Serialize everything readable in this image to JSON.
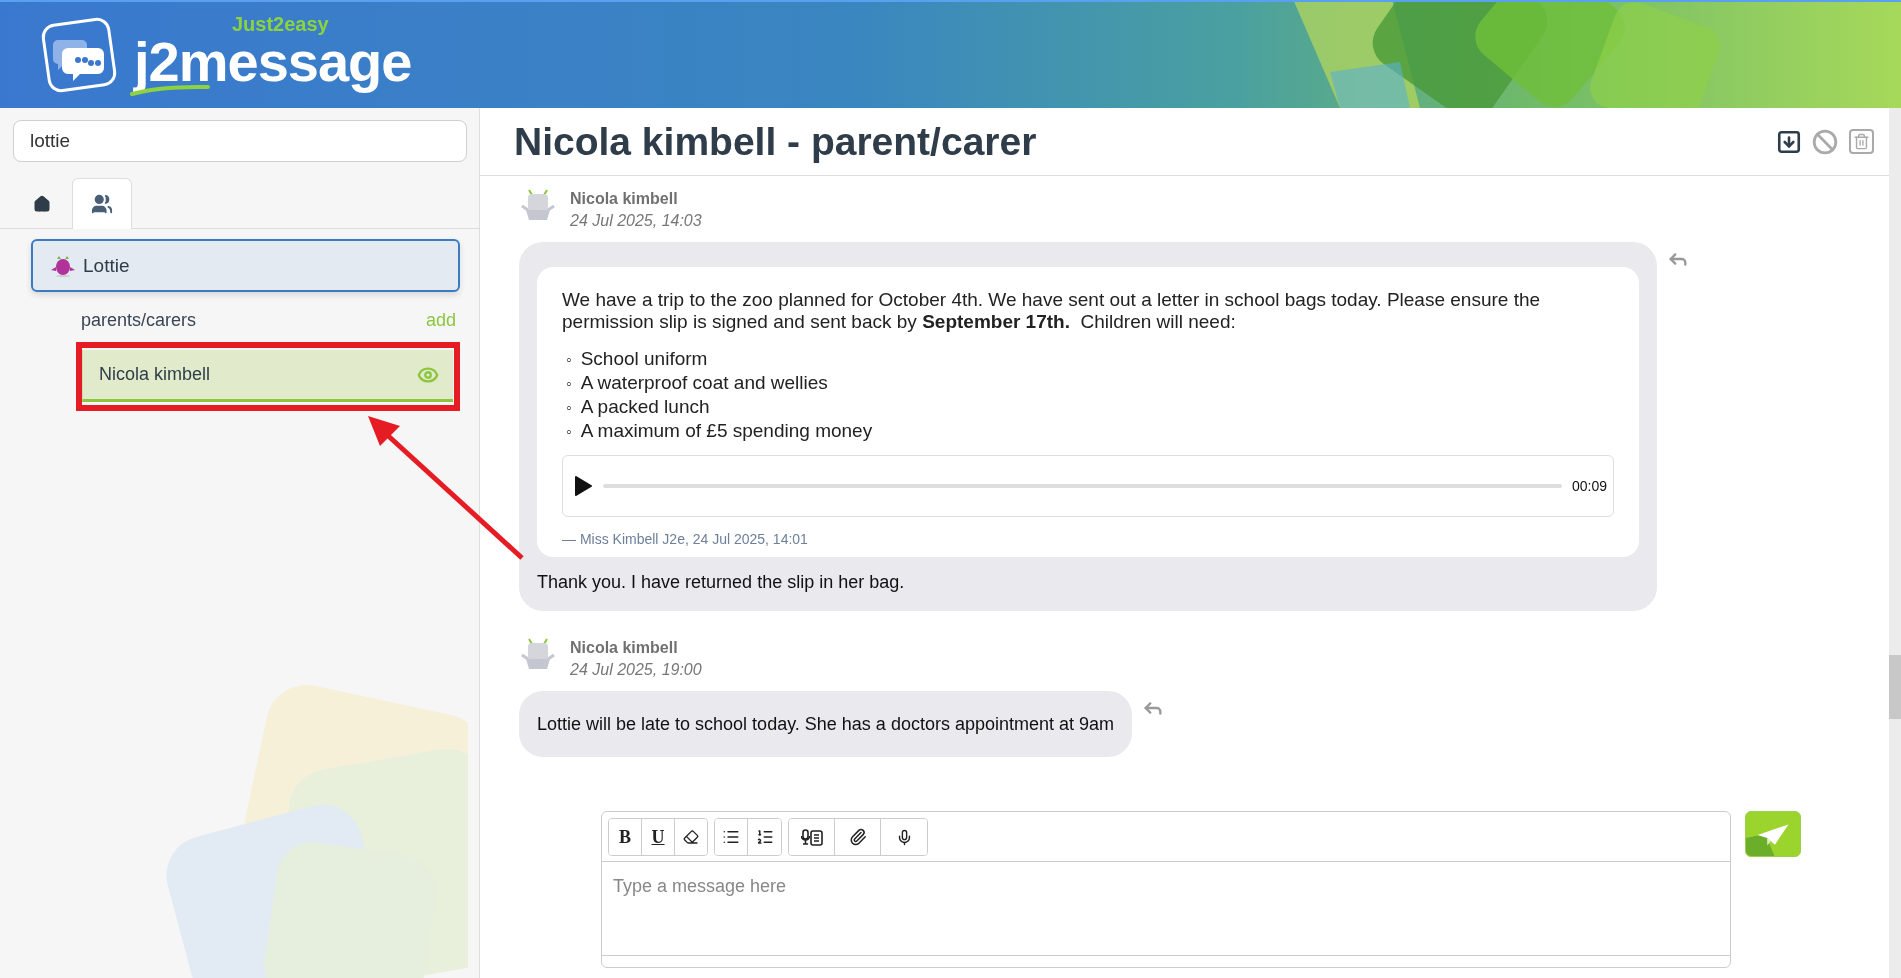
{
  "header": {
    "brand": "Just2easy",
    "logo_text": "j2message"
  },
  "sidebar": {
    "search": {
      "value": "lottie"
    },
    "tabs": [
      {
        "kind": "home",
        "selected": false
      },
      {
        "kind": "group",
        "selected": true
      }
    ],
    "pupils": [
      {
        "name": "Lottie",
        "selected": true,
        "group": {
          "label": "parents/carers",
          "action": "add",
          "members": [
            {
              "name": "Nicola kimbell",
              "selected": true,
              "viewed": true,
              "annotated": true
            }
          ]
        }
      }
    ]
  },
  "annotation_arrow": true,
  "conversation": {
    "title": "Nicola kimbell - parent/carer",
    "actions": [
      {
        "kind": "download",
        "disabled": false
      },
      {
        "kind": "block",
        "disabled": true
      },
      {
        "kind": "delete",
        "disabled": true
      }
    ],
    "messages": [
      {
        "sender": "Nicola kimbell",
        "time": "24 Jul 2025, 14:03",
        "quote": {
          "paragraph": "We have a trip to the zoo planned for October 4th. We have sent out a letter in school bags today. Please ensure the permission slip is signed and sent back by **September 17th.**  Children will need:",
          "marker": "◦",
          "items": [
            "School uniform",
            "A waterproof coat and wellies",
            "A packed lunch",
            "A maximum of £5 spending money"
          ],
          "audio": {
            "duration": "00:09",
            "level": 0
          },
          "signature": "— Miss Kimbell J2e, 24 Jul 2025, 14:01"
        },
        "text": "Thank you. I have returned the slip in her bag."
      },
      {
        "sender": "Nicola kimbell",
        "time": "24 Jul 2025, 19:00",
        "text": "Lottie will be late to school today. She has a doctors appointment at 9am"
      }
    ]
  },
  "composer": {
    "toolbar": [
      {
        "tools": [
          {
            "kind": "bold",
            "label": "B"
          },
          {
            "kind": "underline",
            "label": "U"
          },
          {
            "kind": "eraser"
          }
        ]
      },
      {
        "tools": [
          {
            "kind": "bullets"
          },
          {
            "kind": "numbers"
          }
        ]
      },
      {
        "tools": [
          {
            "kind": "speech"
          },
          {
            "kind": "attach"
          },
          {
            "kind": "mic"
          }
        ]
      }
    ],
    "placeholder": "Type a message here"
  }
}
